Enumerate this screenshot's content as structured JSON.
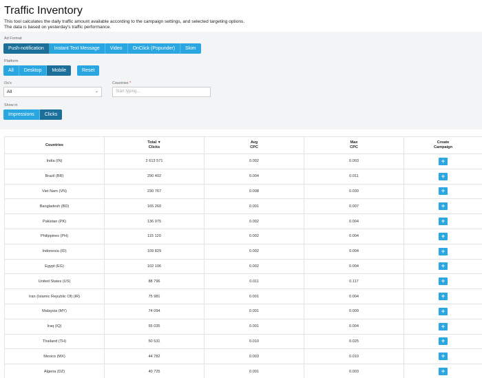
{
  "header": {
    "title": "Traffic Inventory",
    "desc_line1": "This tool calculates the daily traffic amount available according to the campaign settings, and selected targeting options.",
    "desc_line2": "The data is based on yesterday's traffic performance."
  },
  "filters": {
    "ad_format_label": "Ad Format",
    "ad_formats": [
      "Push-notification",
      "Instant Text Message",
      "Video",
      "OnClick (Popunder)",
      "Skim"
    ],
    "ad_format_selected": "Push-notification",
    "platform_label": "Platform",
    "platforms": [
      "All",
      "Desktop",
      "Mobile"
    ],
    "platform_selected": "Mobile",
    "reset_label": "Reset",
    "os_label": "Os's",
    "os_value": "All",
    "countries_label": "Countries",
    "countries_required_mark": "*",
    "countries_placeholder": "Start typing...",
    "show_in_label": "Show in",
    "show_in": [
      "Impressions",
      "Clicks"
    ],
    "show_in_selected": "Clicks"
  },
  "table": {
    "headers": {
      "countries": "Countries",
      "total_line1": "Total",
      "total_line2": "Clicks",
      "avg_line1": "Avg",
      "avg_line2": "CPC",
      "max_line1": "Max",
      "max_line2": "CPC",
      "create_line1": "Create",
      "create_line2": "Campaign"
    },
    "sort_icon": "▼",
    "add_icon": "+",
    "rows": [
      {
        "country": "India (IN)",
        "total": "2 613 571",
        "avg": "0.002",
        "max": "0.003"
      },
      {
        "country": "Brazil (BR)",
        "total": "290 402",
        "avg": "0.004",
        "max": "0.011"
      },
      {
        "country": "Viet Nam (VN)",
        "total": "230 767",
        "avg": "0.008",
        "max": "0.030"
      },
      {
        "country": "Bangladesh (BD)",
        "total": "165 260",
        "avg": "0.001",
        "max": "0.007"
      },
      {
        "country": "Pakistan (PK)",
        "total": "136 975",
        "avg": "0.002",
        "max": "0.004"
      },
      {
        "country": "Philippines (PH)",
        "total": "115 120",
        "avg": "0.002",
        "max": "0.004"
      },
      {
        "country": "Indonesia (ID)",
        "total": "109 829",
        "avg": "0.002",
        "max": "0.004"
      },
      {
        "country": "Egypt (EG)",
        "total": "102 106",
        "avg": "0.002",
        "max": "0.004"
      },
      {
        "country": "United States (US)",
        "total": "88 796",
        "avg": "0.011",
        "max": "0.117"
      },
      {
        "country": "Iran (Islamic Republic Of) (IR)",
        "total": "75 981",
        "avg": "0.001",
        "max": "0.004"
      },
      {
        "country": "Malaysia (MY)",
        "total": "74 094",
        "avg": "0.001",
        "max": "0.009"
      },
      {
        "country": "Iraq (IQ)",
        "total": "55 035",
        "avg": "0.001",
        "max": "0.004"
      },
      {
        "country": "Thailand (TH)",
        "total": "50 531",
        "avg": "0.010",
        "max": "0.025"
      },
      {
        "country": "Mexico (MX)",
        "total": "44 782",
        "avg": "0.003",
        "max": "0.010"
      },
      {
        "country": "Algeria (DZ)",
        "total": "40 725",
        "avg": "0.001",
        "max": "0.003"
      }
    ]
  },
  "colors": {
    "accent": "#2aa6e0",
    "accent_active": "#1b6f99",
    "filter_bg": "#f3f4f5"
  }
}
